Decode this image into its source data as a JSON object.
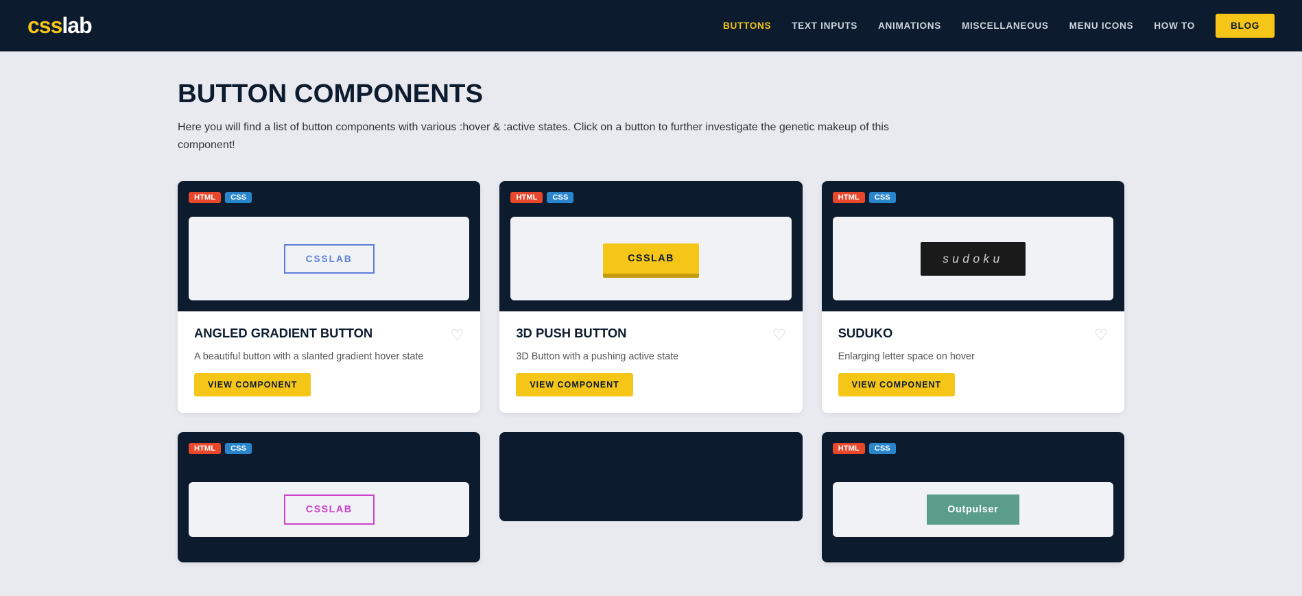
{
  "header": {
    "logo_css": "css",
    "logo_lab": "lab",
    "nav": [
      {
        "label": "BUTTONS",
        "active": true,
        "key": "buttons"
      },
      {
        "label": "TEXT INPUTS",
        "active": false,
        "key": "text-inputs"
      },
      {
        "label": "ANIMATIONS",
        "active": false,
        "key": "animations"
      },
      {
        "label": "MISCELLANEOUS",
        "active": false,
        "key": "miscellaneous"
      },
      {
        "label": "MENU ICONS",
        "active": false,
        "key": "menu-icons"
      },
      {
        "label": "HOW TO",
        "active": false,
        "key": "how-to"
      }
    ],
    "blog_label": "BLOG"
  },
  "page": {
    "title": "BUTTON COMPONENTS",
    "description": "Here you will find a list of button components with various :hover & :active states. Click on a button to further investigate the genetic makeup of this component!"
  },
  "cards": [
    {
      "id": "angled-gradient",
      "tags": [
        "HTML",
        "CSS"
      ],
      "preview_btn_text": "CSSLAB",
      "preview_btn_type": "angled",
      "title": "ANGLED GRADIENT BUTTON",
      "subtitle": "A beautiful button with a slanted gradient hover state",
      "view_label": "VIEW COMPONENT"
    },
    {
      "id": "3d-push",
      "tags": [
        "HTML",
        "CSS"
      ],
      "preview_btn_text": "CSSLAB",
      "preview_btn_type": "3d",
      "title": "3D PUSH BUTTON",
      "subtitle": "3D Button with a pushing active state",
      "view_label": "VIEW COMPONENT"
    },
    {
      "id": "sudoku",
      "tags": [
        "HTML",
        "CSS"
      ],
      "preview_btn_text": "sudoku",
      "preview_btn_type": "sudoku",
      "title": "SUDUKO",
      "subtitle": "Enlarging letter space on hover",
      "view_label": "VIEW COMPONENT"
    },
    {
      "id": "card4",
      "tags": [
        "HTML",
        "CSS"
      ],
      "preview_btn_text": "CSSLab",
      "preview_btn_type": "purple-outline",
      "title": "",
      "subtitle": "",
      "view_label": ""
    },
    {
      "id": "card5",
      "tags": [
        "HTML",
        "CSS"
      ],
      "preview_btn_text": "Outpulser",
      "preview_btn_type": "outpulser",
      "title": "",
      "subtitle": "",
      "view_label": ""
    }
  ]
}
